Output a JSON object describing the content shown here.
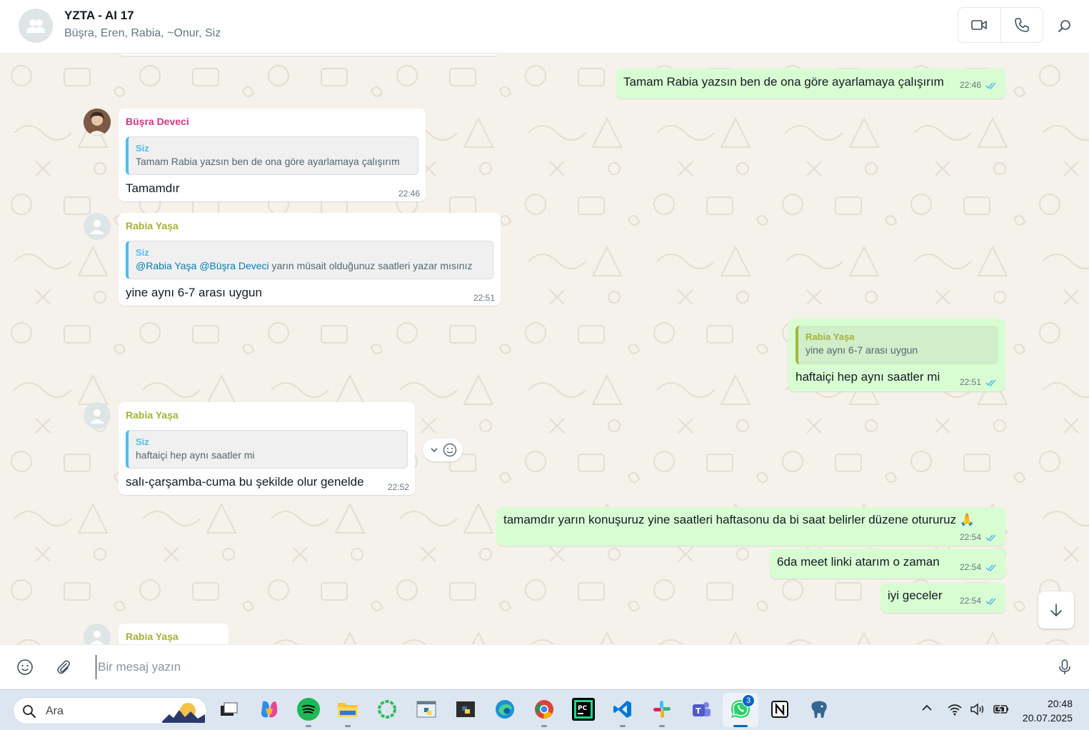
{
  "header": {
    "title": "YZTA - AI 17",
    "members": "Büşra, Eren, Rabia, ~Onur, Siz"
  },
  "messages": {
    "m1": {
      "text": "Tamam Rabia yazsın ben de ona göre ayarlamaya çalışırım",
      "time": "22:46"
    },
    "m2": {
      "sender": "Büşra Deveci",
      "quote_author": "Siz",
      "quote_text": "Tamam Rabia yazsın ben de ona göre ayarlamaya çalışırım",
      "text": "Tamamdır",
      "time": "22:46"
    },
    "m3": {
      "sender": "Rabia Yaşa",
      "quote_author": "Siz",
      "quote_mention1": "@Rabia Yaşa",
      "quote_mention2": "@Büşra Deveci",
      "quote_rest": " yarın müsait olduğunuz saatleri yazar mısınız",
      "text": "yine aynı 6-7 arası uygun",
      "time": "22:51"
    },
    "m4": {
      "quote_author": "Rabia Yaşa",
      "quote_text": "yine aynı 6-7 arası uygun",
      "text": "haftaiçi hep aynı saatler mi",
      "time": "22:51"
    },
    "m5": {
      "sender": "Rabia Yaşa",
      "quote_author": "Siz",
      "quote_text": "haftaiçi hep aynı saatler mi",
      "text": "salı-çarşamba-cuma bu şekilde olur genelde",
      "time": "22:52"
    },
    "m6": {
      "text": "tamamdır yarın konuşuruz yine saatleri haftasonu da bi saat belirler düzene otururuz 🙏",
      "time": "22:54"
    },
    "m7": {
      "text": "6da meet linki atarım o zaman",
      "time": "22:54"
    },
    "m8": {
      "text": "iyi geceler",
      "time": "22:54"
    },
    "m9": {
      "sender": "Rabia Yaşa"
    }
  },
  "composer": {
    "placeholder": "Bir mesaj yazın"
  },
  "taskbar": {
    "search_label": "Ara",
    "whatsapp_badge": "3",
    "time": "20:48",
    "date": "20.07.2025"
  },
  "colors": {
    "sender_busra": "#d63384",
    "sender_rabia": "#a5b337",
    "quote_siz": "#53bdeb",
    "outgoing_bubble": "#d9fdd3",
    "chat_bg": "#f5f1eb",
    "read_ticks": "#53bdeb"
  }
}
